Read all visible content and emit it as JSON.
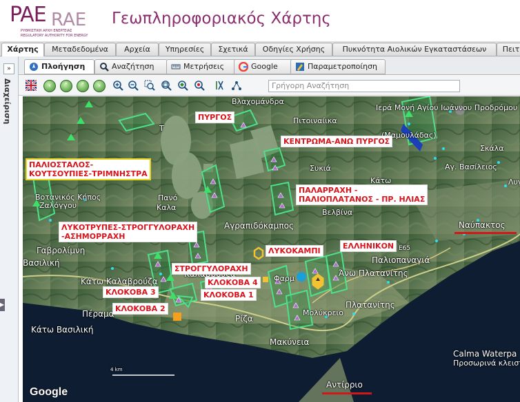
{
  "logo": {
    "main": "PAE",
    "secondary": "RAE",
    "sub_gr": "ΡΥΘΜΙΣΤΙΚΗ ΑΡΧΗ ΕΝΕΡΓΕΙΑΣ",
    "sub_en": "REGULATORY AUTHORITY FOR ENERGY"
  },
  "app_title": "Γεωπληροφοριακός Χάρτης",
  "main_tabs": [
    "Χάρτης",
    "Μεταδεδομένα",
    "Αρχεία",
    "Υπηρεσίες",
    "Σχετικά",
    "Οδηγίες Χρήσης",
    "Πυκνότητα Αιολικών Εγκαταστάσεων",
    "Πειτ"
  ],
  "side_panel": {
    "label": "Διαχείριση",
    "toggle": "»"
  },
  "sub_tabs": [
    "Πλοήγηση",
    "Αναζήτηση",
    "Μετρήσεις",
    "Google",
    "Παραμετροποίηση"
  ],
  "toolbar": {
    "quick_search_placeholder": "Γρήγορη Αναζήτηση"
  },
  "map": {
    "attribution": "Google",
    "scale": "4 km",
    "places": [
      "Βλαχομάνδρα",
      "Πιτοιναίικα",
      "Ιερά Μονή Αγίου Ιωάννου Προδρόμου",
      "(Μαμουλάδας)",
      "Σκάλα",
      "Αγ. Βασίλειος",
      "Λυγ",
      "Συκιά",
      "Κάτω",
      "Τ",
      "Πανό",
      "Καλα",
      "Βοτανικός Κήπος",
      "Ζαλόγγου",
      "Γαβρολίμνη",
      "Βασιλική",
      "Αγραπιδόκαμπος",
      "Βελβίνα",
      "Ναύπακτος",
      "Παλιοπαναγιά",
      "Άνω Πλατανίτης",
      "Πλατανίτης",
      "Καλαβρούζα",
      "Κάτω Καλαβρούζα",
      "Πέραμα",
      "Κάτω Βασιλική",
      "Ρίζα",
      "Μακύνεια",
      "Φαρμ",
      "Μολύκρειο",
      "Calma Waterpa",
      "Προσωρινά κλειστ",
      "Αντίρριο",
      "Ε65"
    ],
    "labels": [
      "ΠΥΡΓΟΣ",
      "ΚΕΝΤΡΩΜΑ-ΑΝΩ ΠΥΡΓΟΣ",
      "ΠΑΛΙΟΣΤΑΛΟΣ-",
      "ΚΟΥΤΣΟΥΠΙΕΣ-ΤΡΙΜΝΗΣΤΡΑ",
      "ΠΑΛΑΡΡΑΧΗ -",
      "ΠΑΛΙΟΠΛΑΤΑΝΟΣ - ΠΡ. ΗΛΙΑΣ",
      "ΛΥΚΟΤΡΥΠΕΣ-ΣΤΡΟΓΓΥΛΟΡΑΧΗ",
      "-ΑΣΗΜΟΡΡΑΧΗ",
      "ΛΥΚΟΚΑΜΠΙ",
      "ΕΛΛΗΝΙΚΟΝ",
      "ΣΤΡΟΓΓΥΛΟΡΑΧΗ",
      "ΚΛΟΚΟΒΑ 4",
      "ΚΛΟΚΟΒΑ 3",
      "ΚΛΟΚΟΒΑ 1",
      "ΚΛΟΚΟΒΑ 2"
    ]
  },
  "colors": {
    "brand": "#8a2e6e",
    "label_red": "#d8141c",
    "polygon_green": "#3ddc6a",
    "highlight_yellow": "#e8d41c"
  }
}
